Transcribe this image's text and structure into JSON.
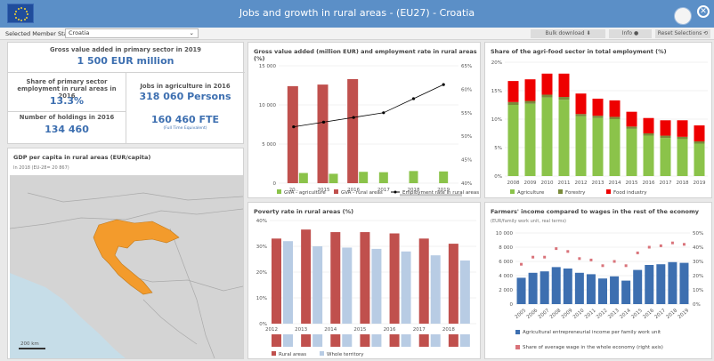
{
  "header": {
    "title": "Jobs and growth in rural areas - (EU27) - Croatia"
  },
  "filter": {
    "label": "Selected Member State:",
    "value": "Croatia"
  },
  "toolbar": {
    "bulk": "Bulk download",
    "info": "Info",
    "reset": "Reset Selections"
  },
  "kpis": {
    "gva_title": "Gross value added in primary sector in 2019",
    "gva_value": "1 500 EUR million",
    "share_title": "Share of primary sector employment in rural areas in 2016",
    "share_value": "13.3%",
    "jobs_title": "Jobs in agriculture in 2016",
    "jobs_value": "318 060 Persons",
    "fte_value": "160 460 FTE",
    "fte_sub": "(Full Time Equivalent)",
    "holdings_title": "Number of holdings in 2016",
    "holdings_value": "134 460"
  },
  "map": {
    "title": "GDP per capita in rural areas (EUR/capita)",
    "subtitle": "In 2018 (EU-28= 20 867)",
    "scale": "200 km"
  },
  "chart_data": [
    {
      "id": "gva",
      "type": "bar",
      "title": "Gross value added (million EUR) and employment rate in rural areas (%)",
      "categories": [
        "20..",
        "2015",
        "2016",
        "2017",
        "2018",
        "2019"
      ],
      "series": [
        {
          "name": "GVA - agriculture",
          "values": [
            1300,
            1200,
            1450,
            1400,
            1550,
            1500
          ],
          "color": "#8bc34a"
        },
        {
          "name": "GVA - rural areas",
          "values": [
            12400,
            12600,
            13300,
            null,
            null,
            null
          ],
          "color": "#c0504d"
        },
        {
          "name": "Employment rate in rural areas",
          "axis": "right",
          "values": [
            52,
            53,
            54,
            55,
            58,
            61
          ],
          "color": "#000000"
        }
      ],
      "ylim": [
        0,
        15000
      ],
      "yticks": [
        0,
        5000,
        10000,
        15000
      ],
      "ytick_labels": [
        "0",
        "5 000",
        "10 000",
        "15 000"
      ],
      "y2lim": [
        40,
        65
      ],
      "y2ticks": [
        40,
        45,
        50,
        55,
        60,
        65
      ],
      "y2tick_labels": [
        "40%",
        "45%",
        "50%",
        "55%",
        "60%",
        "65%"
      ]
    },
    {
      "id": "agrifood",
      "type": "bar",
      "stacked": true,
      "title": "Share of the agri-food sector in total employment (%)",
      "categories": [
        "2008",
        "2009",
        "2010",
        "2011",
        "2012",
        "2013",
        "2014",
        "2015",
        "2016",
        "2017",
        "2018",
        "2019"
      ],
      "series": [
        {
          "name": "Agriculture",
          "values": [
            12.5,
            12.7,
            13.8,
            13.4,
            10.5,
            10.2,
            10,
            8.3,
            7.1,
            6.7,
            6.5,
            5.7
          ],
          "color": "#8bc34a"
        },
        {
          "name": "Forestry",
          "values": [
            0.5,
            0.5,
            0.5,
            0.5,
            0.4,
            0.4,
            0.4,
            0.4,
            0.4,
            0.4,
            0.4,
            0.4
          ],
          "color": "#7a8b3a"
        },
        {
          "name": "Food industry",
          "values": [
            3.7,
            3.8,
            3.7,
            4.1,
            3.6,
            3,
            2.9,
            2.6,
            2.7,
            2.7,
            2.9,
            2.8
          ],
          "color": "#ee0000"
        }
      ],
      "ylim": [
        0,
        20
      ],
      "yticks": [
        0,
        5,
        10,
        15,
        20
      ],
      "ytick_labels": [
        "0%",
        "5%",
        "10%",
        "15%",
        "20%"
      ]
    },
    {
      "id": "poverty",
      "type": "bar",
      "title": "Poverty rate in rural areas (%)",
      "categories": [
        "2012",
        "2013",
        "2014",
        "2015",
        "2016",
        "2017",
        "2018"
      ],
      "series": [
        {
          "name": "Rural areas",
          "values": [
            33,
            36.5,
            35.5,
            35.5,
            35,
            33,
            31
          ],
          "color": "#c0504d"
        },
        {
          "name": "Whole territory",
          "values": [
            32,
            30,
            29.5,
            29,
            28,
            26.5,
            24.5
          ],
          "color": "#b8cce4"
        }
      ],
      "ylim": [
        0,
        40
      ],
      "yticks": [
        0,
        10,
        20,
        30,
        40
      ],
      "ytick_labels": [
        "0%",
        "10%",
        "20%",
        "30%",
        "40%"
      ]
    },
    {
      "id": "income",
      "type": "bar",
      "title": "Farmers' income compared to wages in the rest of the economy",
      "subtitle": "(EUR/family work unit, real terms)",
      "categories": [
        "2005",
        "2006",
        "2007",
        "2008",
        "2009",
        "2010",
        "2011",
        "2012",
        "2013",
        "2014",
        "2015",
        "2016",
        "2017",
        "2018",
        "2019"
      ],
      "series": [
        {
          "name": "Agricultural entrepreneurial income per family work unit",
          "values": [
            3700,
            4400,
            4600,
            5200,
            5000,
            4400,
            4200,
            3600,
            3900,
            3300,
            4800,
            5500,
            5600,
            5900,
            5800
          ],
          "color": "#3d6fb0"
        },
        {
          "name": "Share of average wage in the whole economy (right axis)",
          "axis": "right",
          "values": [
            28,
            33,
            33,
            39,
            37,
            32,
            31,
            27,
            30,
            27,
            36,
            40,
            41,
            43,
            42
          ],
          "color": "#d9737a"
        }
      ],
      "ylim": [
        0,
        10000
      ],
      "yticks": [
        0,
        2000,
        4000,
        6000,
        8000,
        10000
      ],
      "ytick_labels": [
        "0",
        "2 000",
        "4 000",
        "6 000",
        "8 000",
        "10 000"
      ],
      "y2lim": [
        0,
        50
      ],
      "y2ticks": [
        0,
        10,
        20,
        30,
        40,
        50
      ],
      "y2tick_labels": [
        "0%",
        "10%",
        "20%",
        "30%",
        "40%",
        "50%"
      ]
    }
  ]
}
